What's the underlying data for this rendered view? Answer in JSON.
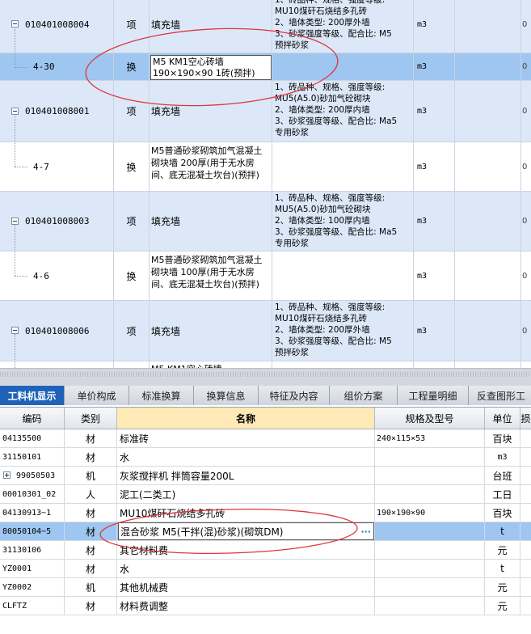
{
  "top_rows": [
    {
      "code": "010401008004",
      "type": "项",
      "name": "填充墙",
      "features": "1、砖品种、规格、强度等级:\nMU10煤矸石烧结多孔砖\n2、墙体类型: 200厚外墙\n3、砂浆强度等级、配合比: M5\n预拌砂浆",
      "unit": "m3",
      "last": "0"
    },
    {
      "code": "4-30",
      "type": "换",
      "name": "M5 KM1空心砖墙\n190×190×90 1砖(预拌)",
      "features": "",
      "unit": "m3",
      "last": "0"
    },
    {
      "code": "010401008001",
      "type": "项",
      "name": "填充墙",
      "features": "1、砖品种、规格、强度等级:\nMU5(A5.0)砂加气砼砌块\n2、墙体类型: 200厚内墙\n3、砂浆强度等级、配合比: Ma5\n专用砂浆",
      "unit": "m3",
      "last": "0"
    },
    {
      "code": "4-7",
      "type": "换",
      "name": "M5普通砂浆砌筑加气混凝土砌块墙 200厚(用于无水房间、底无混凝土坎台)(预拌)",
      "features": "",
      "unit": "m3",
      "last": "0"
    },
    {
      "code": "010401008003",
      "type": "项",
      "name": "填充墙",
      "features": "1、砖品种、规格、强度等级:\nMU5(A5.0)砂加气砼砌块\n2、墙体类型: 100厚内墙\n3、砂浆强度等级、配合比: Ma5\n专用砂浆",
      "unit": "m3",
      "last": "0"
    },
    {
      "code": "4-6",
      "type": "换",
      "name": "M5普通砂浆砌筑加气混凝土砌块墙 100厚(用于无水房间、底无混凝土坎台)(预拌)",
      "features": "",
      "unit": "m3",
      "last": "0"
    },
    {
      "code": "010401008006",
      "type": "项",
      "name": "填充墙",
      "features": "1、砖品种、规格、强度等级:\nMU10煤矸石烧结多孔砖\n2、墙体类型: 200厚外墙\n3、砂浆强度等级、配合比: M5\n预拌砂浆",
      "unit": "m3",
      "last": "0"
    },
    {
      "code": "",
      "type": "",
      "name": "M5 KM1空心砖墙",
      "features": "",
      "unit": "",
      "last": ""
    }
  ],
  "tabs": [
    "工料机显示",
    "单价构成",
    "标准换算",
    "换算信息",
    "特征及内容",
    "组价方案",
    "工程量明细",
    "反查图形工"
  ],
  "bottom_headers": {
    "code": "编码",
    "type": "类别",
    "name": "名称",
    "spec": "规格及型号",
    "unit": "单位",
    "last": "损"
  },
  "bottom_rows": [
    {
      "code": "04135500",
      "type": "材",
      "name": "标准砖",
      "spec": "240×115×53",
      "unit": "百块"
    },
    {
      "code": "31150101",
      "type": "材",
      "name": "水",
      "spec": "",
      "unit": "m3"
    },
    {
      "code": "99050503",
      "type": "机",
      "name": "灰浆搅拌机 拌筒容量200L",
      "spec": "",
      "unit": "台班"
    },
    {
      "code": "00010301_02",
      "type": "人",
      "name": "泥工(二类工)",
      "spec": "",
      "unit": "工日"
    },
    {
      "code": "04130913~1",
      "type": "材",
      "name": "MU10煤矸石烧结多孔砖",
      "spec": "190×190×90",
      "unit": "百块"
    },
    {
      "code": "80050104~5",
      "type": "材",
      "name": "混合砂浆 M5(干拌(混)砂浆)(砌筑DM)",
      "spec": "",
      "unit": "t",
      "ellipsis": "···"
    },
    {
      "code": "31130106",
      "type": "材",
      "name": "其它材料费",
      "spec": "",
      "unit": "元"
    },
    {
      "code": "YZ0001",
      "type": "材",
      "name": "水",
      "spec": "",
      "unit": "t"
    },
    {
      "code": "YZ0002",
      "type": "机",
      "name": "其他机械费",
      "spec": "",
      "unit": "元"
    },
    {
      "code": "CLFTZ",
      "type": "材",
      "name": "材料费调整",
      "spec": "",
      "unit": "元"
    }
  ]
}
